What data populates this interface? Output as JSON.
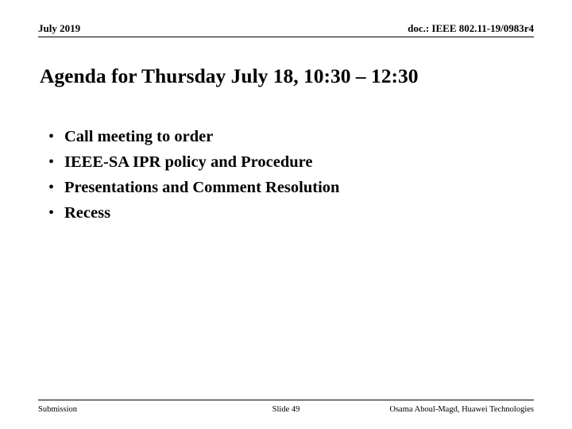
{
  "header": {
    "left": "July 2019",
    "right": "doc.: IEEE 802.11-19/0983r4"
  },
  "title": "Agenda for Thursday July 18, 10:30 – 12:30",
  "bullets": [
    {
      "marker": "•",
      "label": "Call meeting to order"
    },
    {
      "marker": "•",
      "label": "IEEE-SA IPR policy and Procedure"
    },
    {
      "marker": "•",
      "label": "Presentations and Comment Resolution"
    },
    {
      "marker": "•",
      "label": "Recess"
    }
  ],
  "footer": {
    "left": "Submission",
    "center": "Slide 49",
    "right": "Osama Aboul-Magd, Huawei Technologies"
  },
  "colors": {
    "text": "#000000",
    "background": "#ffffff",
    "rule": "#000000"
  }
}
